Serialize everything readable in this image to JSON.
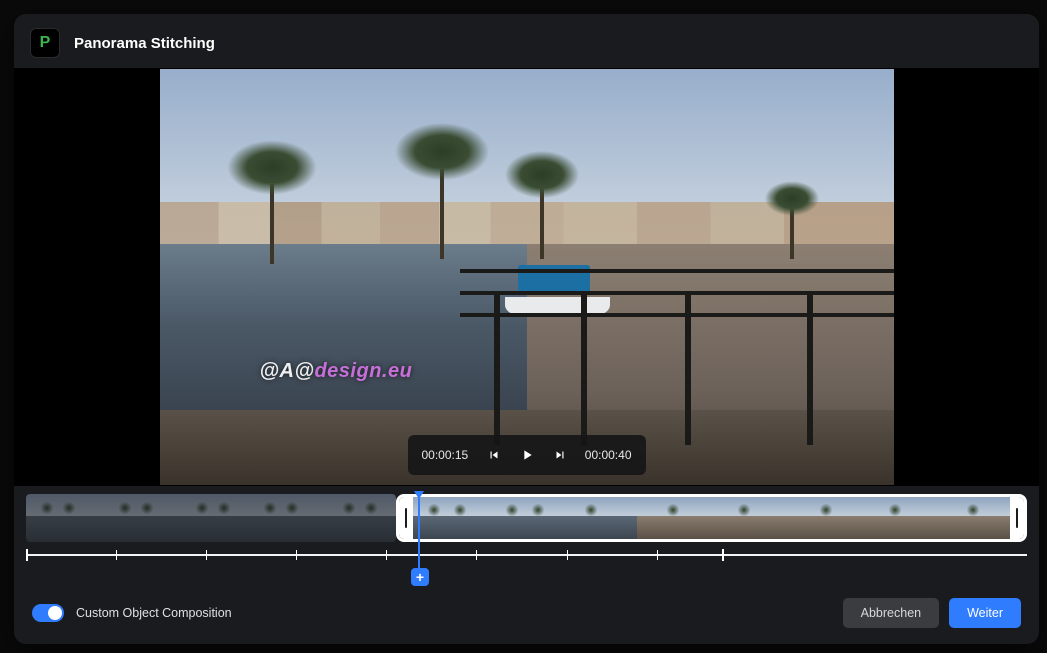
{
  "header": {
    "app_icon_letter": "P",
    "title": "Panorama Stitching"
  },
  "player": {
    "current_time": "00:00:15",
    "total_time": "00:00:40",
    "watermark_prefix": "@A@",
    "watermark_accent": "design.eu"
  },
  "timeline": {
    "add_marker_label": "+"
  },
  "footer": {
    "toggle_label": "Custom Object Composition",
    "cancel_label": "Abbrechen",
    "next_label": "Weiter"
  }
}
